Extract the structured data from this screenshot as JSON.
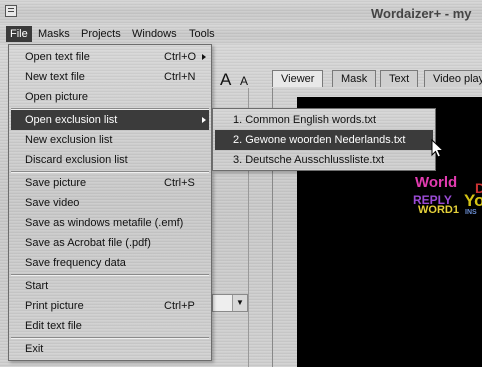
{
  "app_title": "Wordaizer+ - my",
  "menubar": [
    "File",
    "Masks",
    "Projects",
    "Windows",
    "Tools"
  ],
  "toolbar": {
    "font_big": "A",
    "font_small": "A"
  },
  "tabs": [
    "Viewer",
    "Mask",
    "Text",
    "Video play"
  ],
  "file_menu": {
    "open_text_file": {
      "label": "Open text file",
      "shortcut": "Ctrl+O"
    },
    "new_text_file": {
      "label": "New text file",
      "shortcut": "Ctrl+N"
    },
    "open_picture": {
      "label": "Open picture"
    },
    "open_exclusion_list": {
      "label": "Open exclusion list"
    },
    "new_exclusion_list": {
      "label": "New exclusion list"
    },
    "discard_exclusion_list": {
      "label": "Discard exclusion list"
    },
    "save_picture": {
      "label": "Save picture",
      "shortcut": "Ctrl+S"
    },
    "save_video": {
      "label": "Save video"
    },
    "save_emf": {
      "label": "Save as windows metafile (.emf)"
    },
    "save_pdf": {
      "label": "Save as Acrobat file (.pdf)"
    },
    "save_frequency": {
      "label": "Save frequency data"
    },
    "start": {
      "label": "Start"
    },
    "print_picture": {
      "label": "Print picture",
      "shortcut": "Ctrl+P"
    },
    "edit_text_file": {
      "label": "Edit text file"
    },
    "exit": {
      "label": "Exit"
    }
  },
  "exclusion_submenu": [
    "1.  Common English words.txt",
    "2.  Gewone woorden Nederlands.txt",
    "3.  Deutsche Ausschlussliste.txt"
  ],
  "canvas_words": {
    "w1": "World",
    "w2": "REPLY",
    "w3": "Yo",
    "w4": "WORD1",
    "w5": "INS",
    "w6": "D"
  },
  "colors": {
    "menu_highlight": "#3b3b3b",
    "canvas_bg": "#000000"
  }
}
